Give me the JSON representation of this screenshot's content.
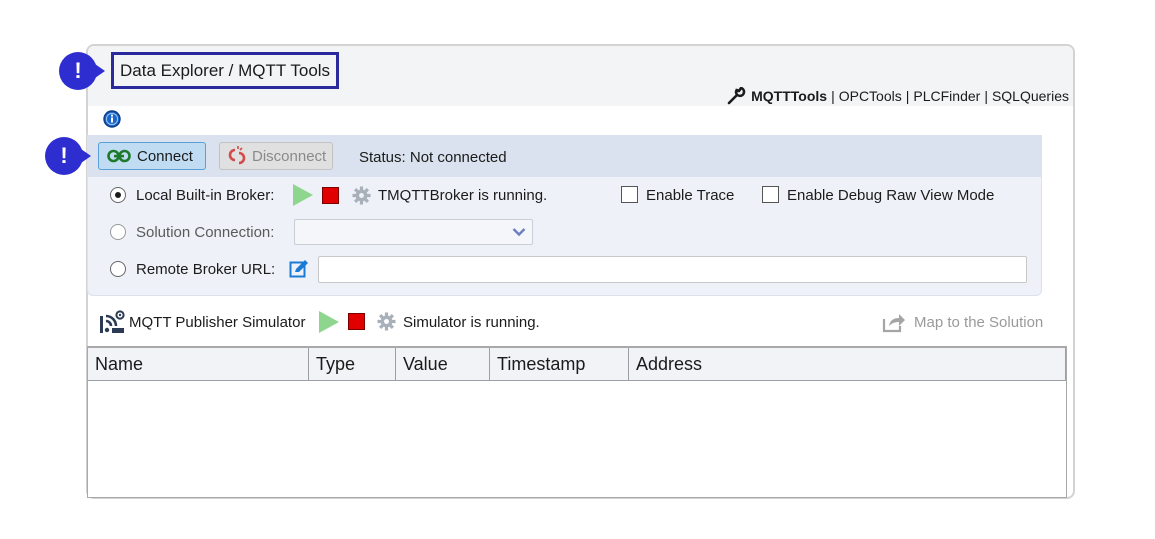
{
  "window": {
    "title": "Data Explorer / MQTT Tools"
  },
  "nav": {
    "links": [
      {
        "label": "MQTTTools",
        "active": true
      },
      {
        "label": "OPCTools",
        "active": false
      },
      {
        "label": "PLCFinder",
        "active": false
      },
      {
        "label": "SQLQueries",
        "active": false
      }
    ],
    "separator": "|"
  },
  "annotations": {
    "badge1": "!",
    "badge2": "!"
  },
  "toolbar": {
    "connect_label": "Connect",
    "disconnect_label": "Disconnect",
    "status_text": "Status: Not connected"
  },
  "broker": {
    "local_label": "Local Built-in Broker:",
    "local_status": "TMQTTBroker is running.",
    "enable_trace_label": "Enable Trace",
    "enable_debug_label": "Enable Debug Raw View Mode",
    "solution_label": "Solution Connection:",
    "solution_value": "",
    "remote_label": "Remote Broker URL:",
    "remote_value": ""
  },
  "simulator": {
    "label": "MQTT Publisher Simulator",
    "status": "Simulator is running.",
    "map_label": "Map to the Solution"
  },
  "grid": {
    "columns": [
      "Name",
      "Type",
      "Value",
      "Timestamp",
      "Address"
    ],
    "rows": []
  },
  "colors": {
    "badge": "#2e2ed0",
    "accent": "#5aa0d8",
    "stop": "#e00000",
    "play": "#8ed68e"
  }
}
